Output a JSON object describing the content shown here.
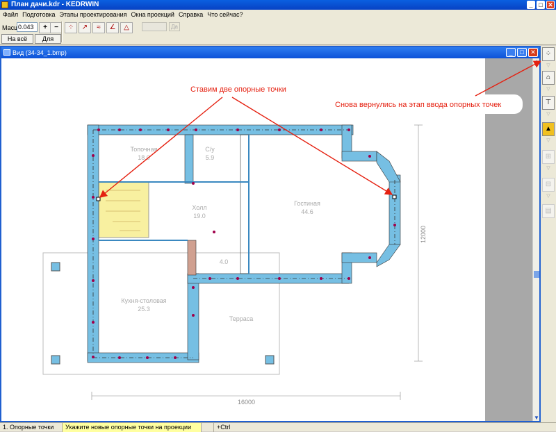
{
  "window": {
    "title": "План дачи.kdr - KEDRWIN",
    "min": "_",
    "max": "□",
    "close": "✕"
  },
  "menu": [
    "Файл",
    "Подготовка",
    "Этапы проектирования",
    "Окна проекций",
    "Справка",
    "Что сейчас?"
  ],
  "toolbar": {
    "scale_label": "Масшт",
    "scale_value": "0.043",
    "zoom_in": "+",
    "zoom_out": "−",
    "fit_all_label": "На всё окно",
    "for_all_label": "Для всех",
    "disabled_btn_label": "Да"
  },
  "child_window": {
    "title": "Вид (34-34_1.bmp)"
  },
  "annotations": {
    "left": "Ставим две опорные точки",
    "right": "Снова вернулись на этап ввода опорных точек"
  },
  "plan": {
    "rooms": [
      {
        "name": "Топочная",
        "area": "18.0"
      },
      {
        "name": "С/у",
        "area": "5.9"
      },
      {
        "name": "Холл",
        "area": "19.0"
      },
      {
        "name": "Гостиная",
        "area": "44.6"
      },
      {
        "name": "Кухня-столовая",
        "area": "25.3"
      },
      {
        "name": "",
        "area": "4.0"
      },
      {
        "name": "Терраса",
        "area": ""
      }
    ],
    "dim_vertical": "12000",
    "dim_horizontal": "16000"
  },
  "status": {
    "stage": "1. Опорные точки",
    "hint": "Укажите новые опорные точки на проекции",
    "modifier": "+Ctrl"
  },
  "colors": {
    "wall": "#76bfe3",
    "stair": "#f8f0a0",
    "annotation": "#e52010",
    "marker": "#a0004a"
  }
}
